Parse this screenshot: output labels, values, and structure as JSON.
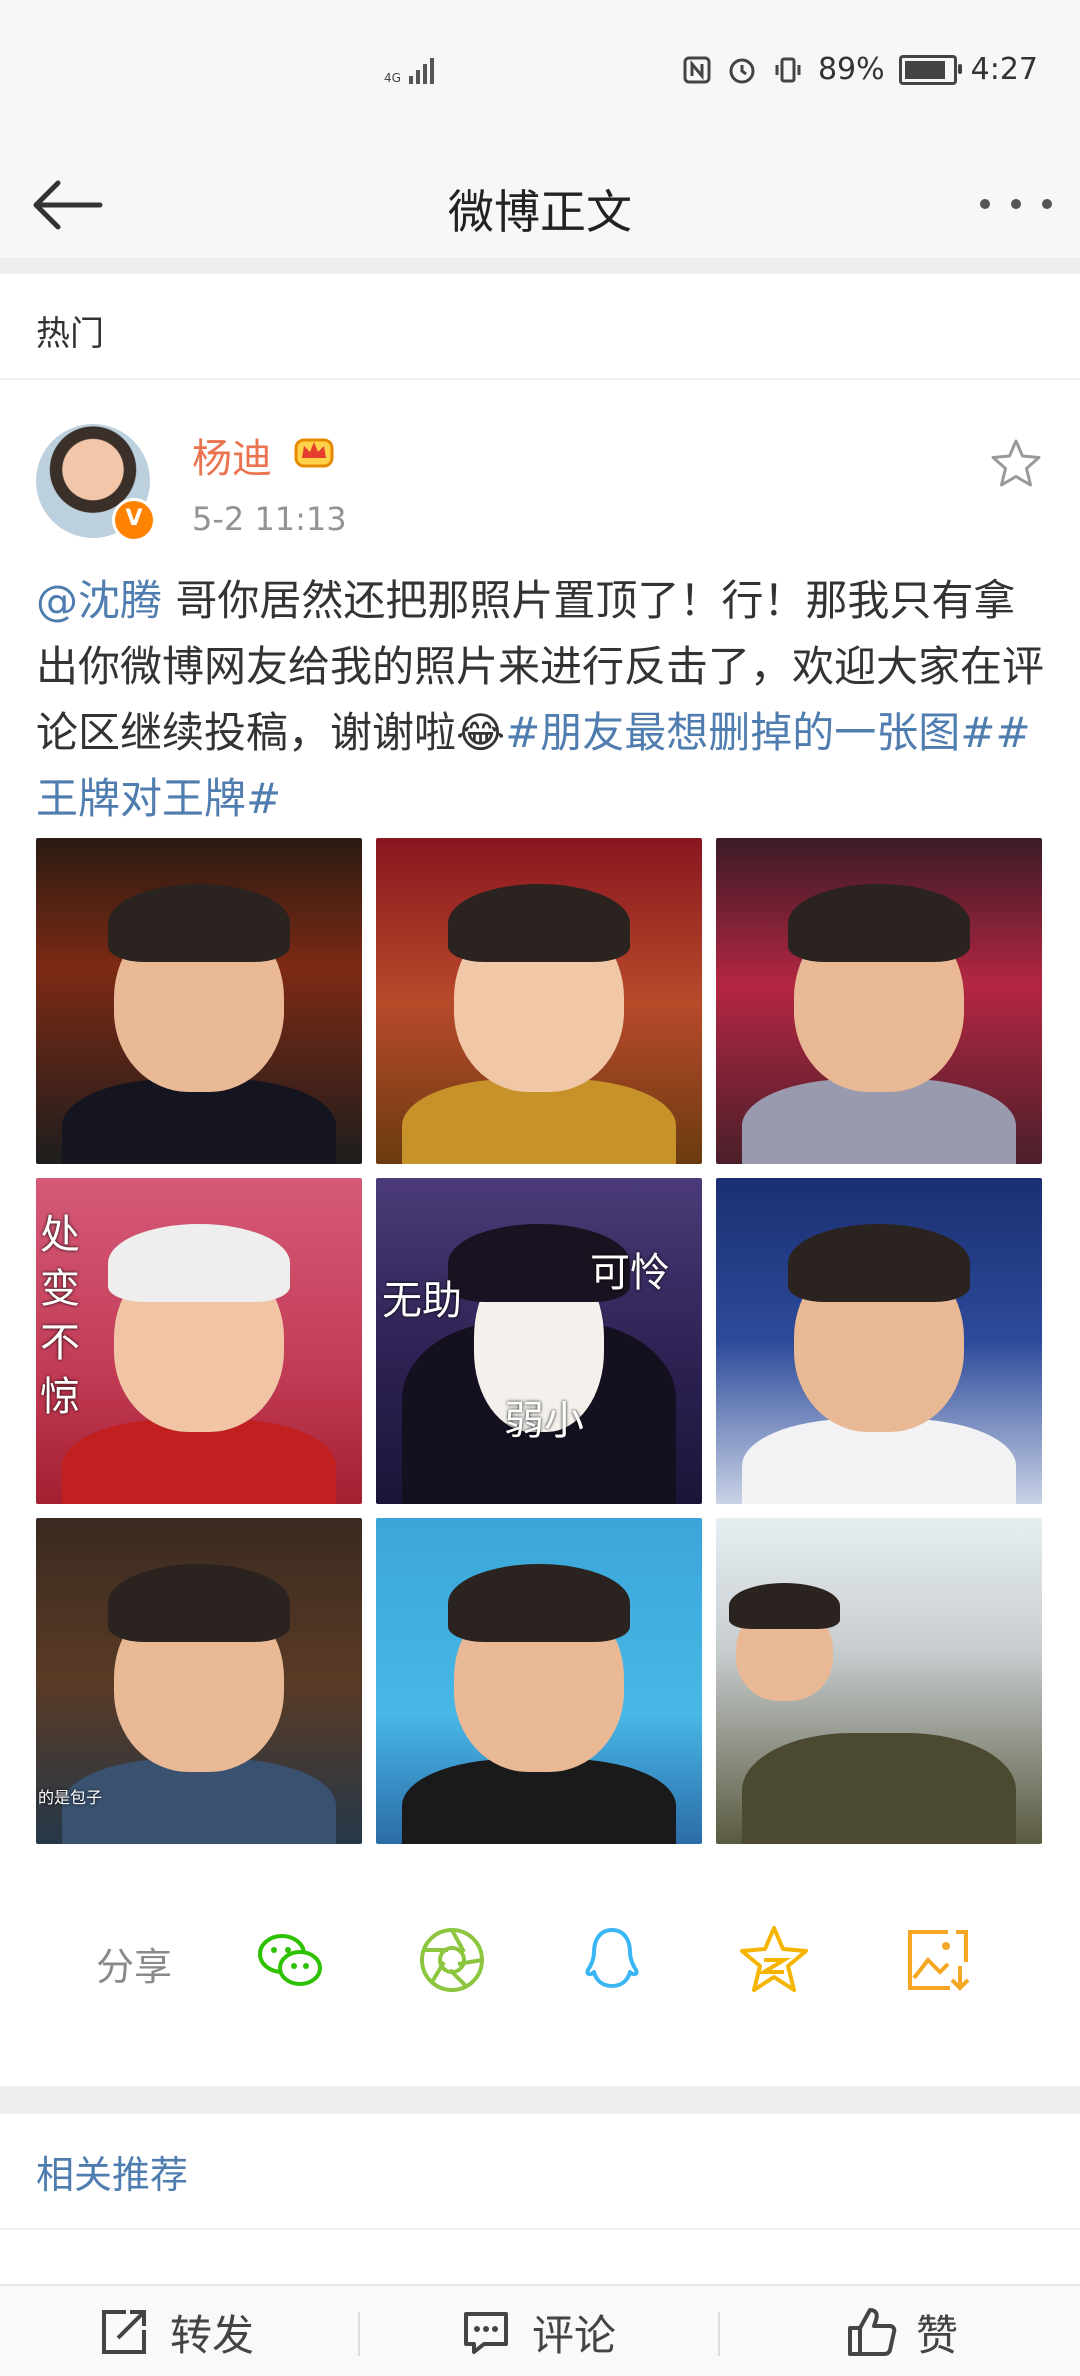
{
  "status_bar": {
    "network": "4G",
    "battery_text": "89%",
    "time": "4:27",
    "battery_level": 0.89
  },
  "header": {
    "title": "微博正文"
  },
  "section": {
    "label": "热门"
  },
  "post": {
    "author": "杨迪",
    "time": "5-2 11:13",
    "avatar_badge": "V",
    "text_parts": {
      "mention": "@沈腾",
      "body": " 哥你居然还把那照片置顶了！行！那我只有拿出你微博网友给我的照片来进行反击了，欢迎大家在评论区继续投稿，谢谢啦",
      "emoji": "😂",
      "hashtag1": "#朋友最想删掉的一张图#",
      "hashtag2": "#王牌对王牌#"
    },
    "images": [
      {
        "overlay": []
      },
      {
        "overlay": []
      },
      {
        "overlay": []
      },
      {
        "overlay": [
          "处",
          "变",
          "不",
          "惊"
        ]
      },
      {
        "overlay": [
          "无助",
          "可怜",
          "弱小"
        ]
      },
      {
        "overlay": []
      },
      {
        "overlay": [
          "的是包子"
        ]
      },
      {
        "overlay": []
      },
      {
        "overlay": []
      }
    ]
  },
  "share": {
    "label": "分享",
    "icons": [
      "wechat-icon",
      "moments-icon",
      "qq-icon",
      "qzone-icon",
      "save-image-icon"
    ],
    "colors": {
      "wechat": "#2dc100",
      "moments": "#8cc63f",
      "qq": "#3ab6f4",
      "qzone": "#f5b400",
      "save": "#f5a623"
    }
  },
  "related": {
    "label": "相关推荐"
  },
  "actions": {
    "repost": "转发",
    "comment": "评论",
    "like": "赞"
  }
}
